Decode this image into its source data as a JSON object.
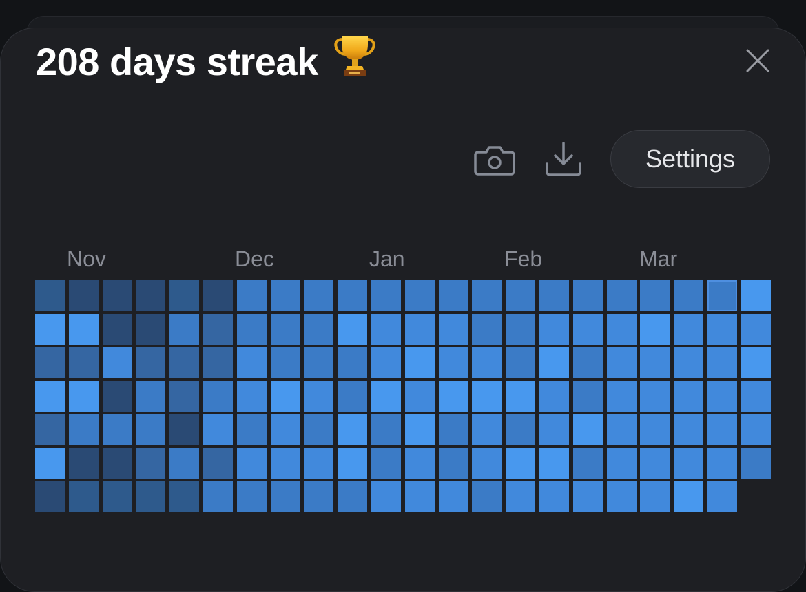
{
  "header": {
    "title": "208 days streak",
    "trophy_icon": "trophy-icon"
  },
  "toolbar": {
    "camera_icon": "camera-icon",
    "download_icon": "download-icon",
    "settings_label": "Settings",
    "close_icon": "close-icon"
  },
  "calendar": {
    "months": [
      "Nov",
      "Dec",
      "Jan",
      "Feb",
      "Mar"
    ],
    "levels": [
      [
        2,
        1,
        1,
        1,
        2,
        1,
        4,
        4,
        4,
        4,
        4,
        4,
        4,
        4,
        4,
        4,
        4,
        4,
        4,
        4,
        4,
        6
      ],
      [
        6,
        6,
        1,
        1,
        4,
        3,
        4,
        4,
        4,
        6,
        5,
        5,
        5,
        4,
        4,
        5,
        5,
        5,
        6,
        5,
        5,
        5
      ],
      [
        3,
        3,
        5,
        3,
        3,
        3,
        5,
        4,
        4,
        4,
        5,
        6,
        5,
        5,
        4,
        6,
        4,
        5,
        5,
        5,
        5,
        6
      ],
      [
        6,
        6,
        1,
        4,
        3,
        4,
        5,
        6,
        5,
        4,
        6,
        5,
        6,
        6,
        6,
        5,
        4,
        5,
        5,
        5,
        5,
        5
      ],
      [
        3,
        4,
        4,
        4,
        1,
        5,
        4,
        5,
        4,
        6,
        4,
        6,
        4,
        5,
        4,
        5,
        6,
        5,
        5,
        5,
        5,
        5
      ],
      [
        6,
        1,
        1,
        3,
        4,
        3,
        5,
        5,
        5,
        6,
        4,
        5,
        4,
        5,
        6,
        6,
        4,
        5,
        5,
        5,
        5,
        4
      ],
      [
        1,
        2,
        2,
        2,
        2,
        4,
        4,
        4,
        4,
        4,
        5,
        5,
        5,
        4,
        5,
        5,
        5,
        5,
        5,
        6,
        5
      ]
    ],
    "palette": {
      "1": "#2a4a74",
      "2": "#2e5a8c",
      "3": "#3566a2",
      "4": "#3b7bc6",
      "5": "#4189dc",
      "6": "#4898ee"
    },
    "today": {
      "row": 0,
      "col": 20
    }
  }
}
